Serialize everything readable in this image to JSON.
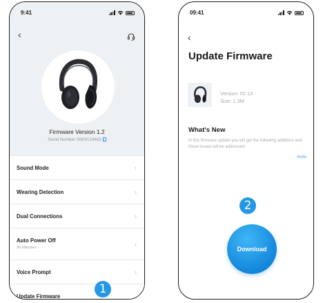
{
  "left_screen": {
    "status_time": "9:41",
    "firmware_version": "Firmware Version 1.2",
    "serial": "Serial Number SN00124483",
    "menu": [
      {
        "label": "Sound Mode",
        "sub": ""
      },
      {
        "label": "Wearing Detection",
        "sub": ""
      },
      {
        "label": "Dual Connections",
        "sub": ""
      },
      {
        "label": "Auto Power Off",
        "sub": "30 Minutes"
      },
      {
        "label": "Voice Prompt",
        "sub": ""
      },
      {
        "label": "Update Firmware",
        "sub": ""
      }
    ],
    "step_badge": "1"
  },
  "right_screen": {
    "status_time": "09:41",
    "title": "Update Firmware",
    "version": "Version: 02.13",
    "size": "Size: 1.3M",
    "whats_new_heading": "What's New",
    "description": "In this firmware update you will get the following additions and these issues will be addressed:",
    "more_link": "more",
    "step_badge": "2",
    "download_label": "Download"
  },
  "icons": {
    "back": "chevron-left-icon",
    "support": "headset-icon",
    "chevron": "chevron-right-icon",
    "copy": "copy-icon"
  },
  "colors": {
    "accent": "#2497e6",
    "background_left": "#eef1f3",
    "muted_text": "#9aa1a6"
  }
}
